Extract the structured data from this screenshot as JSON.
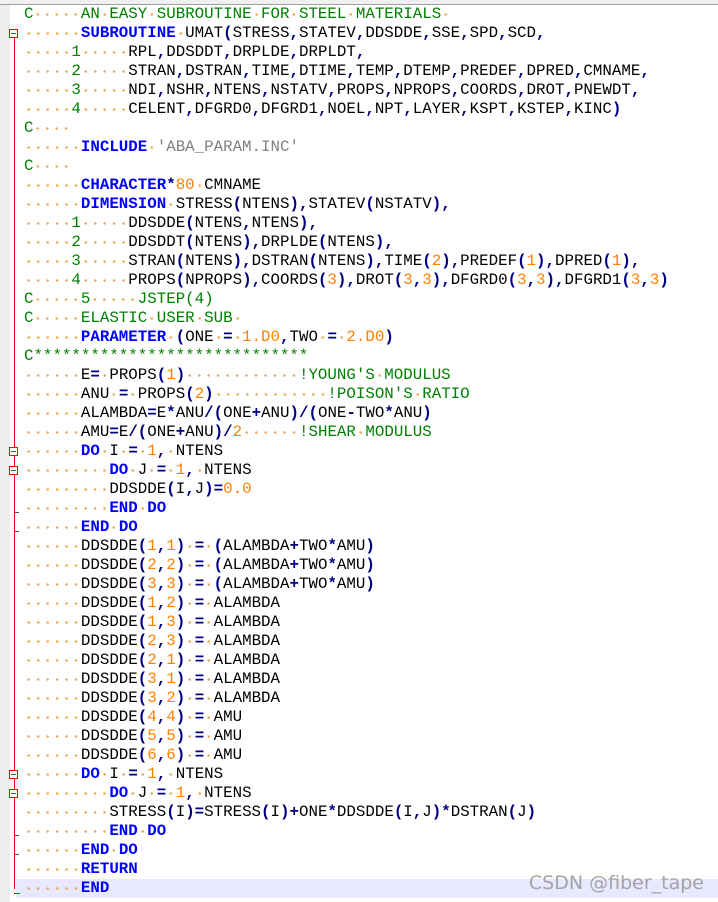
{
  "editor": {
    "current_line": 47,
    "lines": [
      "C     AN EASY SUBROUTINE FOR STEEL MATERIALS ",
      "      SUBROUTINE UMAT(STRESS,STATEV,DDSDDE,SSE,SPD,SCD,",
      "     1     RPL,DDSDDT,DRPLDE,DRPLDT,",
      "     2     STRAN,DSTRAN,TIME,DTIME,TEMP,DTEMP,PREDEF,DPRED,CMNAME,",
      "     3     NDI,NSHR,NTENS,NSTATV,PROPS,NPROPS,COORDS,DROT,PNEWDT,",
      "     4     CELENT,DFGRD0,DFGRD1,NOEL,NPT,LAYER,KSPT,KSTEP,KINC)",
      "C    ",
      "      INCLUDE 'ABA_PARAM.INC'",
      "C    ",
      "      CHARACTER*80 CMNAME",
      "      DIMENSION STRESS(NTENS),STATEV(NSTATV),",
      "     1     DDSDDE(NTENS,NTENS),",
      "     2     DDSDDT(NTENS),DRPLDE(NTENS),",
      "     3     STRAN(NTENS),DSTRAN(NTENS),TIME(2),PREDEF(1),DPRED(1),",
      "     4     PROPS(NPROPS),COORDS(3),DROT(3,3),DFGRD0(3,3),DFGRD1(3,3)",
      "C     5     JSTEP(4)",
      "C     ELASTIC USER SUB ",
      "      PARAMETER (ONE = 1.D0,TWO = 2.D0)",
      "C*****************************",
      "      E= PROPS(1)            !YOUNG'S MODULUS",
      "      ANU = PROPS(2)            !POISON'S RATIO",
      "      ALAMBDA=E*ANU/(ONE+ANU)/(ONE-TWO*ANU)",
      "      AMU=E/(ONE+ANU)/2      !SHEAR MODULUS",
      "      DO I = 1, NTENS",
      "         DO J = 1, NTENS",
      "         DDSDDE(I,J)=0.0",
      "         END DO",
      "      END DO",
      "      DDSDDE(1,1) = (ALAMBDA+TWO*AMU)",
      "      DDSDDE(2,2) = (ALAMBDA+TWO*AMU)",
      "      DDSDDE(3,3) = (ALAMBDA+TWO*AMU)",
      "      DDSDDE(1,2) = ALAMBDA",
      "      DDSDDE(1,3) = ALAMBDA",
      "      DDSDDE(2,3) = ALAMBDA",
      "      DDSDDE(2,1) = ALAMBDA",
      "      DDSDDE(3,1) = ALAMBDA",
      "      DDSDDE(3,2) = ALAMBDA",
      "      DDSDDE(4,4) = AMU",
      "      DDSDDE(5,5) = AMU",
      "      DDSDDE(6,6) = AMU",
      "      DO I = 1, NTENS",
      "         DO J = 1, NTENS",
      "         STRESS(I)=STRESS(I)+ONE*DDSDDE(I,J)*DSTRAN(J)",
      "         END DO",
      "      END DO",
      "      RETURN",
      "      END"
    ],
    "keywords": [
      "SUBROUTINE",
      "INCLUDE",
      "CHARACTER",
      "DIMENSION",
      "PARAMETER",
      "DO",
      "END",
      "RETURN"
    ],
    "fold_open_lines": [
      2,
      24,
      25,
      41,
      42
    ],
    "fold_close_lines": [
      27,
      28,
      44,
      45
    ],
    "fold_last_line": 47
  },
  "colors": {
    "keyword": "#0000FF",
    "number": "#FF8000",
    "comment": "#008000",
    "string": "#808080",
    "operator": "#000080",
    "fold_marker": "#FF0000",
    "current_line_bg": "#E8E8FF"
  },
  "watermark": "CSDN @fiber_tape"
}
